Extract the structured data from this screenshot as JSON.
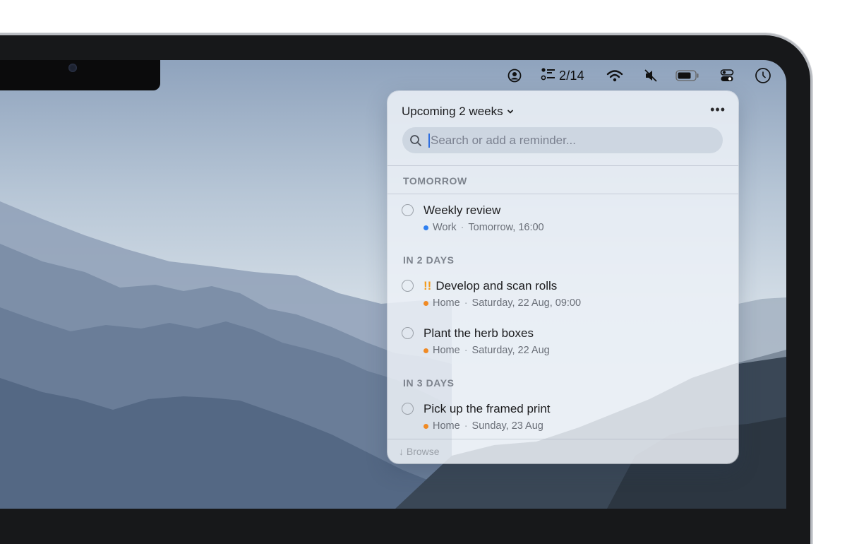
{
  "menubar": {
    "user_icon": "person-circle-icon",
    "reminders_icon": "checklist-icon",
    "reminders_count": "2/14",
    "wifi_icon": "wifi-icon",
    "mute_icon": "speaker-muted-icon",
    "battery_icon": "battery-icon",
    "control_center_icon": "control-center-icon",
    "clock_icon": "clock-icon"
  },
  "popover": {
    "title": "Upcoming 2 weeks",
    "more_icon": "ellipsis-icon",
    "search": {
      "placeholder": "Search or add a reminder..."
    },
    "sections": [
      {
        "label": "TOMORROW",
        "items": [
          {
            "title": "Weekly review",
            "priority": "",
            "list": "Work",
            "list_color": "#2f7ff0",
            "due": "Tomorrow, 16:00"
          }
        ]
      },
      {
        "label": "IN 2 DAYS",
        "items": [
          {
            "title": "Develop and scan rolls",
            "priority": "!!",
            "list": "Home",
            "list_color": "#f08a24",
            "due": "Saturday, 22 Aug, 09:00"
          },
          {
            "title": "Plant the herb boxes",
            "priority": "",
            "list": "Home",
            "list_color": "#f08a24",
            "due": "Saturday, 22 Aug"
          }
        ]
      },
      {
        "label": "IN 3 DAYS",
        "items": [
          {
            "title": "Pick up the framed print",
            "priority": "",
            "list": "Home",
            "list_color": "#f08a24",
            "due": "Sunday, 23 Aug"
          }
        ]
      }
    ],
    "footer": "↓ Browse"
  }
}
